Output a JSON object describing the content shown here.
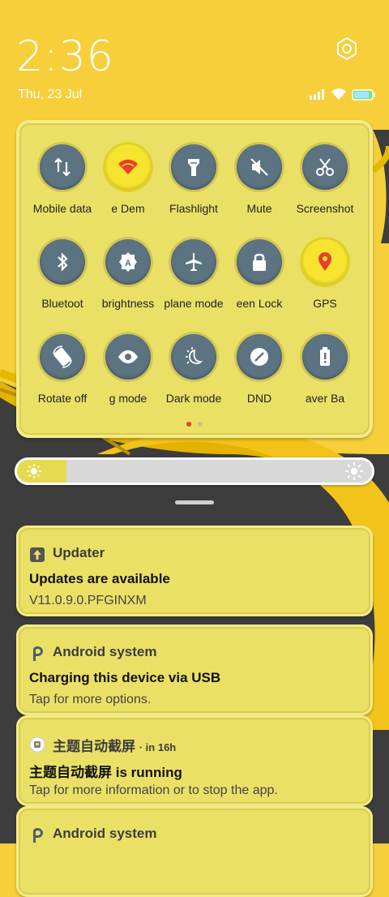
{
  "status": {
    "time": "2:36",
    "date": "Thu, 23 Jul"
  },
  "quick_settings": {
    "tiles": [
      {
        "label": "Mobile data",
        "icon": "mobile-data-icon",
        "active": false
      },
      {
        "label": "e    Dem",
        "icon": "wifi-icon",
        "active": true
      },
      {
        "label": "Flashlight",
        "icon": "flashlight-icon",
        "active": false
      },
      {
        "label": "Mute",
        "icon": "mute-icon",
        "active": false
      },
      {
        "label": "Screenshot",
        "icon": "screenshot-icon",
        "active": false
      },
      {
        "label": "Bluetoot",
        "icon": "bluetooth-icon",
        "active": false
      },
      {
        "label": "brightness",
        "icon": "auto-brightness-icon",
        "active": false
      },
      {
        "label": "plane mode",
        "icon": "airplane-icon",
        "active": false
      },
      {
        "label": "een    Lock",
        "icon": "lock-icon",
        "active": false
      },
      {
        "label": "GPS",
        "icon": "location-icon",
        "active": true
      },
      {
        "label": "Rotate off",
        "icon": "rotate-icon",
        "active": false
      },
      {
        "label": "g mode",
        "icon": "reading-mode-icon",
        "active": false
      },
      {
        "label": "Dark mode",
        "icon": "dark-mode-icon",
        "active": false
      },
      {
        "label": "DND",
        "icon": "dnd-icon",
        "active": false
      },
      {
        "label": "aver    Ba",
        "icon": "battery-saver-icon",
        "active": false
      }
    ],
    "page": 1,
    "page_count": 2
  },
  "brightness": {
    "level": 0.14
  },
  "notifications": [
    {
      "app": "Updater",
      "meta": "",
      "title": "Updates are available",
      "text": "V11.0.9.0.PFGINXM",
      "icon": "update-arrow-icon"
    },
    {
      "app": "Android system",
      "meta": "",
      "title": "Charging this device via USB",
      "text": "Tap for more options.",
      "icon": "android-p-icon"
    },
    {
      "app": "主题自动截屏",
      "meta": "· in 16h",
      "title": "主题自动截屏 is running",
      "text": "Tap for more information or to stop the app.",
      "icon": "app-icon"
    },
    {
      "app": "Android system",
      "meta": "",
      "title": "",
      "text": "",
      "icon": "android-p-icon"
    }
  ],
  "colors": {
    "wallpaper_yellow": "#f6cf3a",
    "panel": "#ebe066",
    "tile_off": "#5c7381",
    "tile_on": "#f6e42e",
    "accent_red": "#e8412a"
  }
}
